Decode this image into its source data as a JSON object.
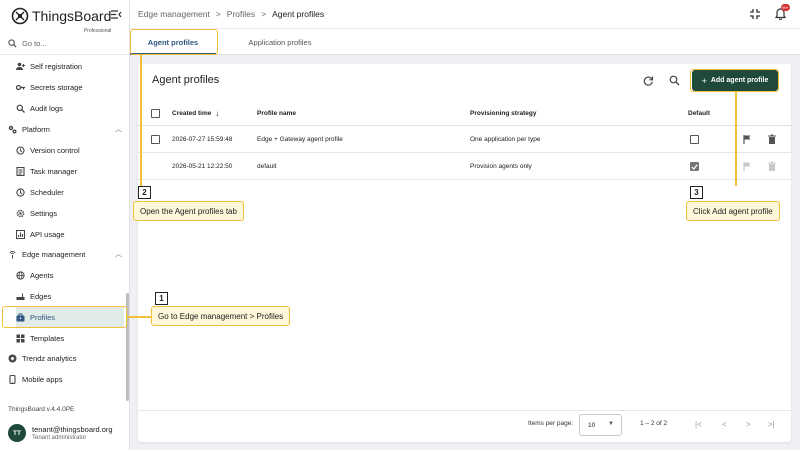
{
  "app": {
    "brand": "ThingsBoard",
    "brand_sub": "Professional",
    "goto_placeholder": "Go to...",
    "version": "ThingsBoard v.4.4.0PE",
    "notification_count": "99+"
  },
  "user": {
    "initials": "TT",
    "email": "tenant@thingsboard.org",
    "role": "Tenant administrator"
  },
  "sidebar": {
    "items": [
      {
        "label": "Self registration",
        "icon": "person-add-icon"
      },
      {
        "label": "Secrets storage",
        "icon": "key-icon"
      },
      {
        "label": "Audit logs",
        "icon": "search-doc-icon"
      },
      {
        "label": "Platform",
        "icon": "gears-icon"
      },
      {
        "label": "Version control",
        "icon": "history-icon"
      },
      {
        "label": "Task manager",
        "icon": "checklist-icon"
      },
      {
        "label": "Scheduler",
        "icon": "clock-icon"
      },
      {
        "label": "Settings",
        "icon": "gear-icon"
      },
      {
        "label": "API usage",
        "icon": "chart-icon"
      },
      {
        "label": "Edge management",
        "icon": "antenna-icon"
      },
      {
        "label": "Agents",
        "icon": "globe-icon"
      },
      {
        "label": "Edges",
        "icon": "router-icon"
      },
      {
        "label": "Profiles",
        "icon": "briefcase-icon"
      },
      {
        "label": "Templates",
        "icon": "grid-icon"
      },
      {
        "label": "Trendz analytics",
        "icon": "trendz-icon"
      },
      {
        "label": "Mobile apps",
        "icon": "phone-icon"
      }
    ]
  },
  "header": {
    "crumbs": [
      "Edge management",
      ">",
      "Profiles",
      ">",
      "Agent profiles"
    ]
  },
  "tabs": [
    {
      "label": "Agent profiles",
      "active": true
    },
    {
      "label": "Application profiles",
      "active": false
    }
  ],
  "card": {
    "title": "Agent profiles",
    "add_label": "Add agent profile",
    "columns": [
      "Created time",
      "Profile name",
      "Provisioning strategy",
      "Default"
    ],
    "rows": [
      {
        "created": "2026-07-27 15:59:48",
        "name": "Edge + Gateway agent profile",
        "strategy": "One application per type",
        "default": false
      },
      {
        "created": "2026-05-21 12:22:50",
        "name": "default",
        "strategy": "Provision agents only",
        "default": true
      }
    ],
    "items_per_page_label": "Items per page:",
    "items_per_page": "10",
    "range": "1 – 2 of 2"
  },
  "callouts": [
    {
      "num": "1",
      "text": "Go to Edge management > Profiles"
    },
    {
      "num": "2",
      "text": "Open the Agent profiles tab"
    },
    {
      "num": "3",
      "text": "Click Add agent profile"
    }
  ],
  "colors": {
    "accent": "#305680",
    "primary_button": "#1f4a3a",
    "highlight": "#f3c03a",
    "active_nav_bg": "#e1ece8"
  }
}
